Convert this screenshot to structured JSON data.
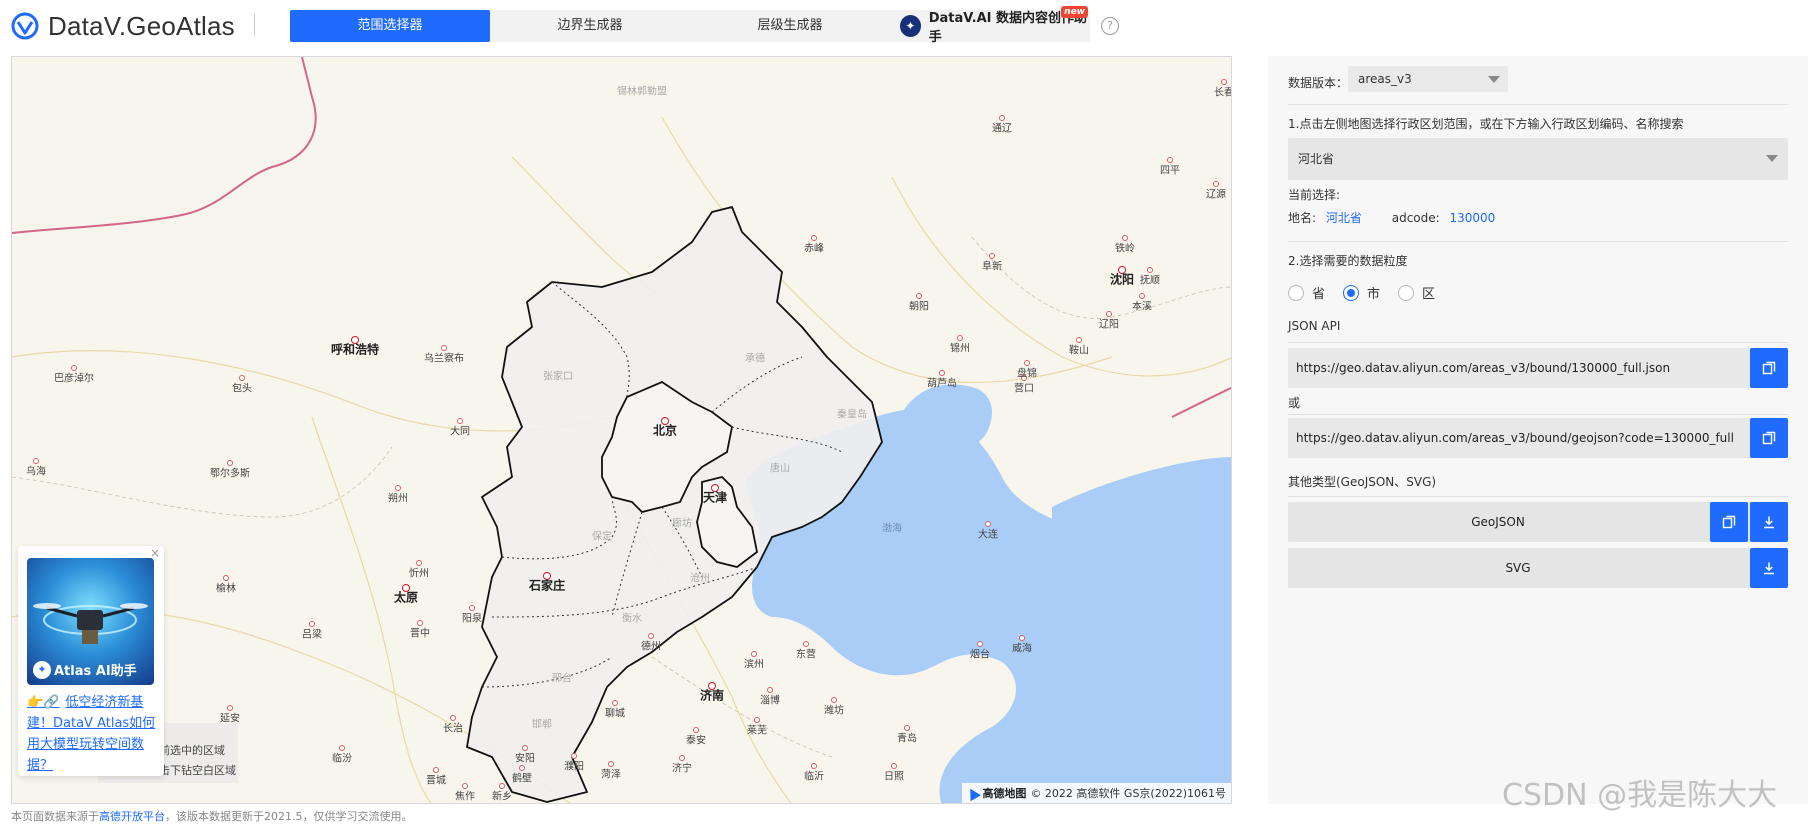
{
  "header": {
    "brand": "DataV.GeoAtlas",
    "tabs": [
      "范围选择器",
      "边界生成器",
      "层级生成器"
    ],
    "ai_tab": {
      "label": "DataV.AI 数据内容创作助手",
      "badge": "new"
    },
    "help": "?"
  },
  "map": {
    "provinces": [
      "北京",
      "天津",
      "石家庄"
    ],
    "cities": [
      {
        "name": "呼和浩特",
        "kind": "big"
      },
      {
        "name": "太原",
        "kind": "big"
      },
      {
        "name": "沈阳",
        "kind": "big"
      },
      {
        "name": "济南",
        "kind": "big"
      },
      {
        "name": "乌兰察布",
        "kind": "mid"
      },
      {
        "name": "巴彦淖尔",
        "kind": "mid"
      },
      {
        "name": "包头",
        "kind": "mid"
      },
      {
        "name": "鄂尔多斯",
        "kind": "mid"
      },
      {
        "name": "乌海",
        "kind": "mid"
      },
      {
        "name": "大同",
        "kind": "mid"
      },
      {
        "name": "朔州",
        "kind": "mid"
      },
      {
        "name": "忻州",
        "kind": "mid"
      },
      {
        "name": "吕梁",
        "kind": "mid"
      },
      {
        "name": "阳泉",
        "kind": "mid"
      },
      {
        "name": "晋中",
        "kind": "mid"
      },
      {
        "name": "榆林",
        "kind": "mid"
      },
      {
        "name": "赤峰",
        "kind": "mid"
      },
      {
        "name": "朝阳",
        "kind": "mid"
      },
      {
        "name": "阜新",
        "kind": "mid"
      },
      {
        "name": "锦州",
        "kind": "mid"
      },
      {
        "name": "葫芦岛",
        "kind": "mid"
      },
      {
        "name": "营口",
        "kind": "mid"
      },
      {
        "name": "盘锦",
        "kind": "mid"
      },
      {
        "name": "鞍山",
        "kind": "mid"
      },
      {
        "name": "辽阳",
        "kind": "mid"
      },
      {
        "name": "本溪",
        "kind": "mid"
      },
      {
        "name": "抚顺",
        "kind": "mid"
      },
      {
        "name": "铁岭",
        "kind": "mid"
      },
      {
        "name": "四平",
        "kind": "mid"
      },
      {
        "name": "辽源",
        "kind": "mid"
      },
      {
        "name": "通辽",
        "kind": "mid"
      },
      {
        "name": "长春",
        "kind": "mid"
      },
      {
        "name": "大连",
        "kind": "mid"
      },
      {
        "name": "烟台",
        "kind": "mid"
      },
      {
        "name": "威海",
        "kind": "mid"
      },
      {
        "name": "东营",
        "kind": "mid"
      },
      {
        "name": "滨州",
        "kind": "mid"
      },
      {
        "name": "德州",
        "kind": "mid"
      },
      {
        "name": "聊城",
        "kind": "mid"
      },
      {
        "name": "淄博",
        "kind": "mid"
      },
      {
        "name": "潍坊",
        "kind": "mid"
      },
      {
        "name": "泰安",
        "kind": "mid"
      },
      {
        "name": "莱芜",
        "kind": "mid"
      },
      {
        "name": "临沂",
        "kind": "mid"
      },
      {
        "name": "日照",
        "kind": "mid"
      },
      {
        "name": "青岛",
        "kind": "mid"
      },
      {
        "name": "菏泽",
        "kind": "mid"
      },
      {
        "name": "济宁",
        "kind": "mid"
      },
      {
        "name": "安阳",
        "kind": "mid"
      },
      {
        "name": "鹤壁",
        "kind": "mid"
      },
      {
        "name": "新乡",
        "kind": "mid"
      },
      {
        "name": "濮阳",
        "kind": "mid"
      },
      {
        "name": "焦作",
        "kind": "mid"
      },
      {
        "name": "长治",
        "kind": "mid"
      },
      {
        "name": "晋城",
        "kind": "mid"
      },
      {
        "name": "临汾",
        "kind": "mid"
      },
      {
        "name": "延安",
        "kind": "mid"
      },
      {
        "name": "锡林郭勒盟",
        "kind": "faint"
      },
      {
        "name": "张家口",
        "kind": "faint"
      },
      {
        "name": "承德",
        "kind": "faint"
      },
      {
        "name": "唐山",
        "kind": "faint"
      },
      {
        "name": "秦皇岛",
        "kind": "faint"
      },
      {
        "name": "廊坊",
        "kind": "faint"
      },
      {
        "name": "保定",
        "kind": "faint"
      },
      {
        "name": "沧州",
        "kind": "faint"
      },
      {
        "name": "衡水",
        "kind": "faint"
      },
      {
        "name": "邢台",
        "kind": "faint"
      },
      {
        "name": "邯郸",
        "kind": "faint"
      }
    ],
    "sea": "渤海",
    "attribution": {
      "logo": "高德地图",
      "text": "© 2022 高德软件 GS京(2022)1061号"
    },
    "legend_lines": [
      "当前选中的区域",
      "单击下钻空白区域"
    ]
  },
  "promo": {
    "close": "×",
    "badge": "Atlas AI助手",
    "emoji": "👉🔗",
    "link": "低空经济新基建！DataV Atlas如何用大模型玩转空间数据？"
  },
  "footer": {
    "prefix": "本页面数据来源于",
    "link": "高德开放平台",
    "suffix": "，该版本数据更新于2021.5，仅供学习交流使用。"
  },
  "panel": {
    "version_label": "数据版本：",
    "version_value": "areas_v3",
    "step1": "1.点击左侧地图选择行政区划范围，或在下方输入行政区划编码、名称搜索",
    "region_value": "河北省",
    "current_label": "当前选择:",
    "place_label": "地名:",
    "place_value": "河北省",
    "adcode_label": "adcode:",
    "adcode_value": "130000",
    "step2": "2.选择需要的数据粒度",
    "granularity": [
      {
        "label": "省",
        "checked": false
      },
      {
        "label": "市",
        "checked": true
      },
      {
        "label": "区",
        "checked": false
      }
    ],
    "json_api_label": "JSON API",
    "api_url_1": "https://geo.datav.aliyun.com/areas_v3/bound/130000_full.json",
    "or_label": "或",
    "api_url_2": "https://geo.datav.aliyun.com/areas_v3/bound/geojson?code=130000_full",
    "other_types_label": "其他类型(GeoJSON、SVG)",
    "geojson_label": "GeoJSON",
    "svg_label": "SVG"
  },
  "watermark": "CSDN @我是陈大大"
}
